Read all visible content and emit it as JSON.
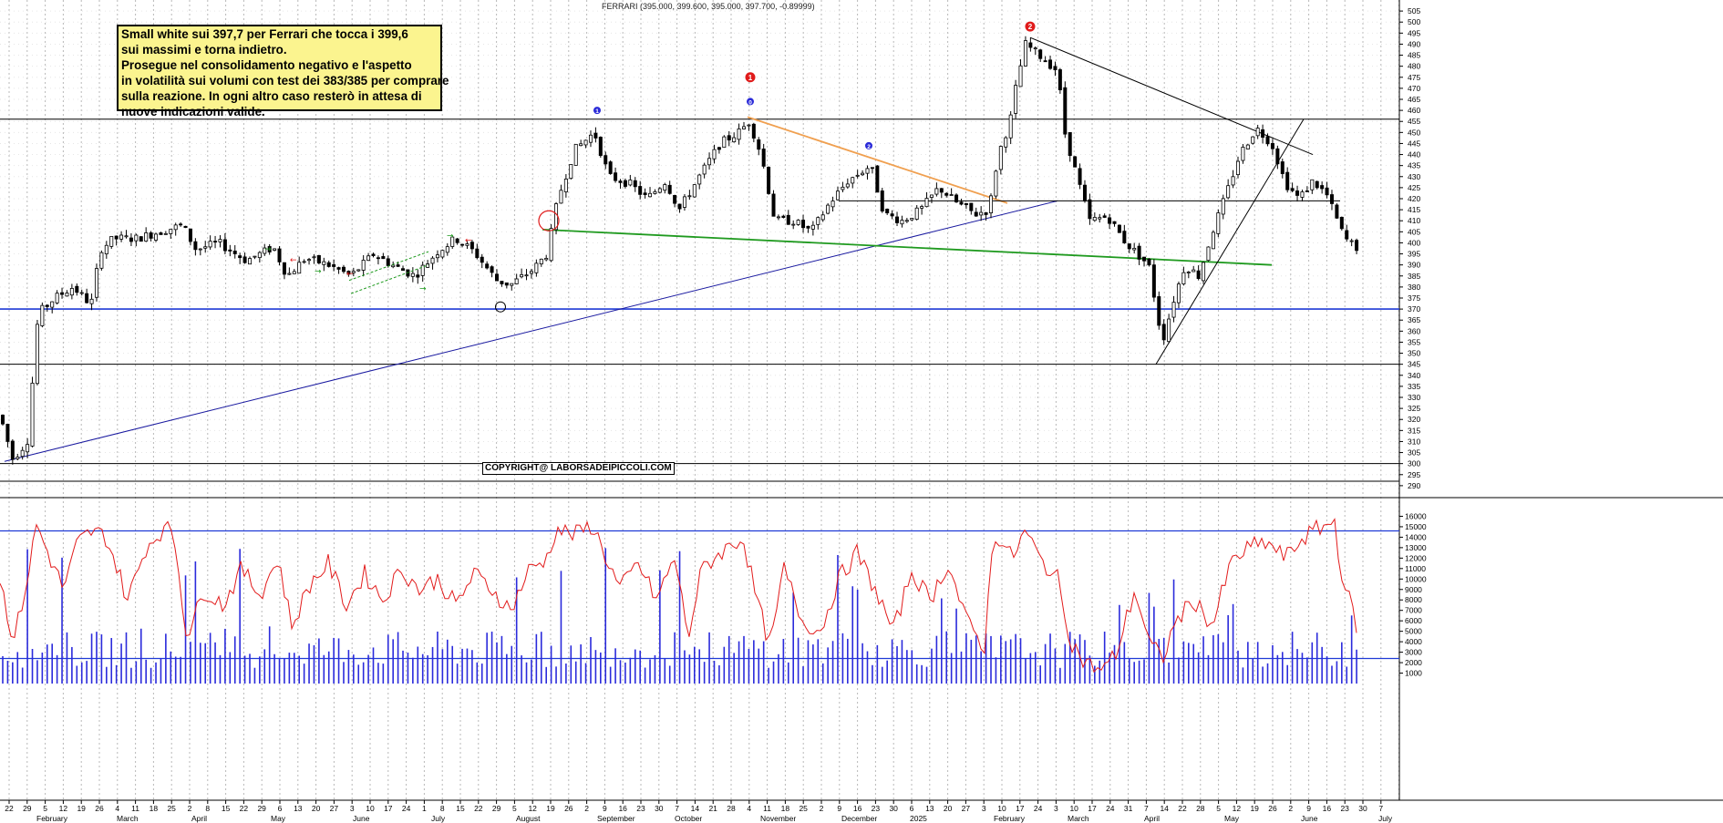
{
  "header": "FERRARI (395.000, 399.600, 395.000, 397.700, -0.89999)",
  "note": [
    "Small white sui 397,7 per Ferrari che tocca i 399,6",
    "sui massimi e torna indietro.",
    "Prosegue nel consolidamento negativo e l'aspetto",
    "in volatilità sui volumi con test dei 383/385 per comprare",
    "sulla reazione. In ogni altro caso resterò in attesa di",
    "nuove indicazioni valide."
  ],
  "copyright": "COPYRIGHT@ LABORSADEIPICCOLI.COM",
  "colors": {
    "candle": "#000000",
    "trend_blue": "#1a1aa0",
    "trend_orange": "#f0a050",
    "trend_green": "#1f9a1f",
    "volume": "#2a2adb",
    "oscillator": "#e21b1b",
    "hline_blue": "#1f3ad6"
  },
  "chart_data": [
    {
      "type": "candlestick",
      "title": "FERRARI (395.000, 399.600, 395.000, 397.700, -0.89999)",
      "ylim": [
        285,
        510
      ],
      "y_ticks": [
        290,
        295,
        300,
        305,
        310,
        315,
        320,
        325,
        330,
        335,
        340,
        345,
        350,
        355,
        360,
        365,
        370,
        375,
        380,
        385,
        390,
        395,
        400,
        405,
        410,
        415,
        420,
        425,
        430,
        435,
        440,
        445,
        450,
        455,
        460,
        465,
        470,
        475,
        480,
        485,
        490,
        495,
        500,
        505
      ],
      "last": {
        "open": 395.0,
        "high": 399.6,
        "low": 395.0,
        "close": 397.7,
        "change": -0.89999
      },
      "x_day_labels": [
        "22",
        "29",
        "5",
        "12",
        "19",
        "26",
        "4",
        "11",
        "18",
        "25",
        "2",
        "8",
        "15",
        "22",
        "29",
        "6",
        "13",
        "20",
        "27",
        "3",
        "10",
        "17",
        "24",
        "1",
        "8",
        "15",
        "22",
        "29",
        "5",
        "12",
        "19",
        "26",
        "2",
        "9",
        "16",
        "23",
        "30",
        "7",
        "14",
        "21",
        "28",
        "4",
        "11",
        "18",
        "25",
        "2",
        "9",
        "16",
        "23",
        "30",
        "6",
        "13",
        "20",
        "27",
        "3",
        "10",
        "17",
        "24",
        "3",
        "10",
        "17",
        "24",
        "31",
        "7",
        "14",
        "22",
        "28",
        "5",
        "12",
        "19",
        "26",
        "2",
        "9",
        "16",
        "23",
        "30",
        "7"
      ],
      "x_month_labels": [
        "February",
        "March",
        "April",
        "May",
        "June",
        "July",
        "August",
        "September",
        "October",
        "November",
        "December",
        "2025",
        "February",
        "March",
        "April",
        "May",
        "June",
        "July"
      ],
      "price_path": [
        [
          0,
          322
        ],
        [
          14,
          302
        ],
        [
          30,
          310
        ],
        [
          42,
          368
        ],
        [
          60,
          375
        ],
        [
          80,
          380
        ],
        [
          100,
          372
        ],
        [
          110,
          397
        ],
        [
          125,
          402
        ],
        [
          150,
          402
        ],
        [
          175,
          405
        ],
        [
          200,
          408
        ],
        [
          215,
          397
        ],
        [
          240,
          400
        ],
        [
          270,
          392
        ],
        [
          300,
          398
        ],
        [
          315,
          385
        ],
        [
          335,
          393
        ],
        [
          360,
          390
        ],
        [
          385,
          385
        ],
        [
          410,
          395
        ],
        [
          430,
          390
        ],
        [
          455,
          385
        ],
        [
          480,
          396
        ],
        [
          500,
          402
        ],
        [
          520,
          396
        ],
        [
          545,
          383
        ],
        [
          560,
          381
        ],
        [
          585,
          388
        ],
        [
          600,
          395
        ],
        [
          612,
          420
        ],
        [
          630,
          442
        ],
        [
          652,
          450
        ],
        [
          668,
          430
        ],
        [
          690,
          427
        ],
        [
          710,
          420
        ],
        [
          730,
          428
        ],
        [
          745,
          415
        ],
        [
          770,
          432
        ],
        [
          790,
          445
        ],
        [
          810,
          450
        ],
        [
          822,
          455
        ],
        [
          835,
          440
        ],
        [
          850,
          410
        ],
        [
          870,
          410
        ],
        [
          890,
          405
        ],
        [
          910,
          418
        ],
        [
          930,
          428
        ],
        [
          955,
          435
        ],
        [
          970,
          413
        ],
        [
          990,
          410
        ],
        [
          1010,
          415
        ],
        [
          1030,
          425
        ],
        [
          1050,
          418
        ],
        [
          1070,
          413
        ],
        [
          1085,
          415
        ],
        [
          1095,
          440
        ],
        [
          1108,
          455
        ],
        [
          1115,
          472
        ],
        [
          1125,
          490
        ],
        [
          1140,
          485
        ],
        [
          1160,
          478
        ],
        [
          1168,
          450
        ],
        [
          1178,
          435
        ],
        [
          1195,
          410
        ],
        [
          1215,
          412
        ],
        [
          1235,
          400
        ],
        [
          1260,
          390
        ],
        [
          1275,
          355
        ],
        [
          1288,
          375
        ],
        [
          1300,
          390
        ],
        [
          1315,
          385
        ],
        [
          1330,
          405
        ],
        [
          1345,
          422
        ],
        [
          1360,
          440
        ],
        [
          1378,
          452
        ],
        [
          1395,
          445
        ],
        [
          1410,
          427
        ],
        [
          1425,
          420
        ],
        [
          1440,
          428
        ],
        [
          1455,
          422
        ],
        [
          1462,
          415
        ],
        [
          1475,
          402
        ],
        [
          1488,
          398
        ]
      ],
      "horizontal_levels": [
        {
          "y": 456,
          "color": "black"
        },
        {
          "y": 370,
          "color": "blue"
        },
        {
          "y": 345,
          "color": "black"
        },
        {
          "y": 300,
          "color": "black"
        },
        {
          "y": 292,
          "color": "black"
        }
      ],
      "trendlines": [
        {
          "from": [
            5,
            301
          ],
          "to": [
            1160,
            419
          ],
          "color": "blue"
        },
        {
          "from": [
            820,
            457
          ],
          "to": [
            1105,
            418
          ],
          "color": "orange"
        },
        {
          "from": [
            595,
            406
          ],
          "to": [
            1395,
            390
          ],
          "color": "green"
        },
        {
          "from": [
            920,
            419
          ],
          "to": [
            1470,
            419
          ],
          "color": "black"
        },
        {
          "from": [
            1130,
            493
          ],
          "to": [
            1440,
            440
          ],
          "color": "black"
        },
        {
          "from": [
            1268,
            345
          ],
          "to": [
            1430,
            456
          ],
          "color": "black"
        }
      ],
      "markers": [
        {
          "label": "1",
          "color": "red",
          "x": 823,
          "price": 475
        },
        {
          "label": "2",
          "color": "red",
          "x": 1130,
          "price": 498
        },
        {
          "label": "0",
          "color": "blue",
          "x": 823,
          "price": 464
        },
        {
          "label": "1",
          "color": "blue",
          "x": 655,
          "price": 460
        },
        {
          "label": "2",
          "color": "blue",
          "x": 953,
          "price": 444
        }
      ]
    },
    {
      "type": "bar+line",
      "title": "Volume & oscillator",
      "ylim": [
        0,
        17000
      ],
      "y_ticks": [
        1000,
        2000,
        3000,
        4000,
        5000,
        6000,
        7000,
        8000,
        9000,
        10000,
        11000,
        12000,
        13000,
        14000,
        15000,
        16000
      ],
      "reference_levels": [
        14600,
        2400
      ],
      "oscillator_path": [
        [
          0,
          10000
        ],
        [
          15,
          4000
        ],
        [
          30,
          10000
        ],
        [
          40,
          15200
        ],
        [
          55,
          12000
        ],
        [
          70,
          9000
        ],
        [
          85,
          13500
        ],
        [
          100,
          14500
        ],
        [
          115,
          14200
        ],
        [
          125,
          12000
        ],
        [
          140,
          8000
        ],
        [
          160,
          13000
        ],
        [
          175,
          14500
        ],
        [
          190,
          14800
        ],
        [
          205,
          4500
        ],
        [
          225,
          9000
        ],
        [
          245,
          7500
        ],
        [
          265,
          11000
        ],
        [
          285,
          8500
        ],
        [
          305,
          12000
        ],
        [
          320,
          5500
        ],
        [
          340,
          9500
        ],
        [
          360,
          11500
        ],
        [
          380,
          7500
        ],
        [
          400,
          10500
        ],
        [
          420,
          8000
        ],
        [
          440,
          11000
        ],
        [
          460,
          9000
        ],
        [
          480,
          10000
        ],
        [
          500,
          7500
        ],
        [
          520,
          10500
        ],
        [
          540,
          9000
        ],
        [
          560,
          7000
        ],
        [
          580,
          10800
        ],
        [
          600,
          12000
        ],
        [
          610,
          14800
        ],
        [
          630,
          14200
        ],
        [
          650,
          15200
        ],
        [
          665,
          12000
        ],
        [
          680,
          9000
        ],
        [
          700,
          11500
        ],
        [
          720,
          8000
        ],
        [
          740,
          12000
        ],
        [
          755,
          4500
        ],
        [
          770,
          11000
        ],
        [
          790,
          12500
        ],
        [
          815,
          14000
        ],
        [
          830,
          8000
        ],
        [
          845,
          3500
        ],
        [
          860,
          11000
        ],
        [
          880,
          6000
        ],
        [
          900,
          5000
        ],
        [
          920,
          10000
        ],
        [
          940,
          12500
        ],
        [
          960,
          9000
        ],
        [
          980,
          5000
        ],
        [
          1000,
          10800
        ],
        [
          1020,
          8000
        ],
        [
          1040,
          11500
        ],
        [
          1060,
          6000
        ],
        [
          1080,
          3500
        ],
        [
          1090,
          14600
        ],
        [
          1110,
          12000
        ],
        [
          1125,
          14600
        ],
        [
          1140,
          12000
        ],
        [
          1160,
          10000
        ],
        [
          1175,
          4000
        ],
        [
          1190,
          2000
        ],
        [
          1210,
          1200
        ],
        [
          1225,
          3000
        ],
        [
          1245,
          9000
        ],
        [
          1260,
          4000
        ],
        [
          1275,
          2300
        ],
        [
          1290,
          6000
        ],
        [
          1310,
          8000
        ],
        [
          1330,
          5500
        ],
        [
          1350,
          11500
        ],
        [
          1370,
          13000
        ],
        [
          1390,
          13500
        ],
        [
          1410,
          12000
        ],
        [
          1430,
          14000
        ],
        [
          1450,
          15000
        ],
        [
          1465,
          15500
        ],
        [
          1470,
          11000
        ],
        [
          1480,
          8000
        ],
        [
          1490,
          5000
        ]
      ]
    }
  ]
}
